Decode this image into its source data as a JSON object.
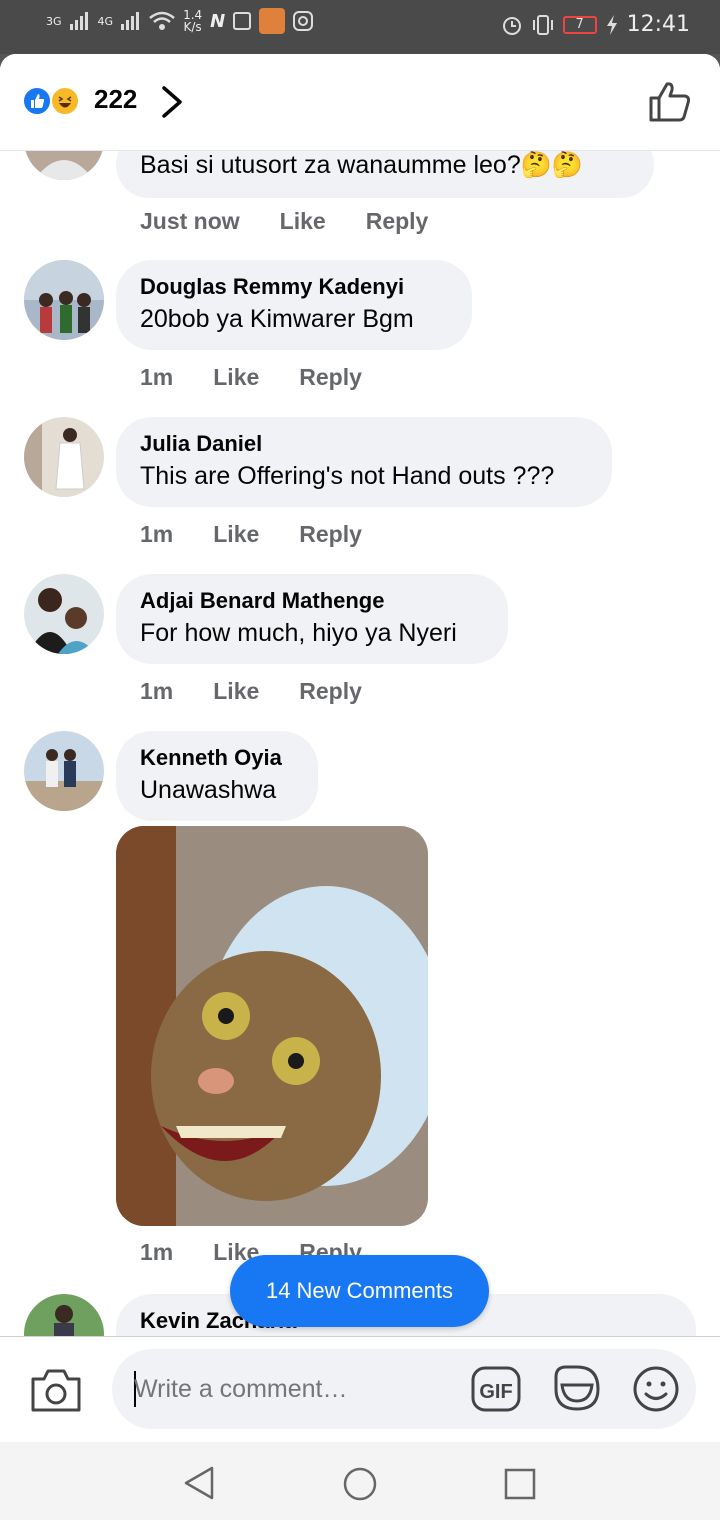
{
  "status_bar": {
    "network_1": "3G",
    "network_2": "4G",
    "speed_value": "1.4",
    "speed_unit": "K/s",
    "battery": "7",
    "time": "12:41",
    "icons": [
      "signal-icon",
      "wifi-icon",
      "n-icon",
      "message-icon",
      "app-icon",
      "instagram-icon",
      "alarm-icon",
      "vibrate-icon",
      "battery-icon",
      "charging-icon"
    ]
  },
  "header": {
    "reaction_count": "222",
    "reactions": [
      "like-reaction-icon",
      "haha-reaction-icon"
    ],
    "colors": {
      "like": "#1877f2",
      "haha": "#f7b928"
    }
  },
  "comments": [
    {
      "name": "",
      "text": "Basi si utusort za wanaumme leo?🤔🤔",
      "time": "Just now",
      "like": "Like",
      "reply": "Reply"
    },
    {
      "name": "Douglas Remmy Kadenyi",
      "text": "20bob ya Kimwarer Bgm",
      "time": "1m",
      "like": "Like",
      "reply": "Reply"
    },
    {
      "name": "Julia Daniel",
      "text": "This are Offering's not Hand outs ???",
      "time": "1m",
      "like": "Like",
      "reply": "Reply"
    },
    {
      "name": "Adjai Benard Mathenge",
      "text": "For how much, hiyo ya Nyeri",
      "time": "1m",
      "like": "Like",
      "reply": "Reply"
    },
    {
      "name": "Kenneth Oyia",
      "text": "Unawashwa",
      "time": "1m",
      "like": "Like",
      "reply": "Reply"
    },
    {
      "name": "Kevin Zacharia",
      "text": "",
      "time": "",
      "like": "",
      "reply": ""
    }
  ],
  "new_comments_button": "14 New Comments",
  "composer": {
    "placeholder": "Write a comment…",
    "gif_label": "GIF"
  },
  "colors": {
    "accent": "#1877f2",
    "bubble": "#f0f2f5",
    "meta": "#65676b",
    "text": "#050505"
  }
}
